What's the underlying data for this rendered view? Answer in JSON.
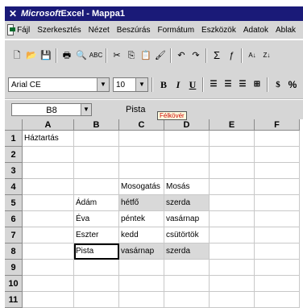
{
  "title": {
    "app": "Microsoft",
    "rest": " Excel - Mappa1"
  },
  "menu": [
    "Fájl",
    "Szerkesztés",
    "Nézet",
    "Beszúrás",
    "Formátum",
    "Eszközök",
    "Adatok",
    "Ablak"
  ],
  "font": {
    "name": "Arial CE",
    "size": "10"
  },
  "format_buttons": [
    "B",
    "I",
    "U",
    "%"
  ],
  "name_box": "B8",
  "formula_content": "Pista",
  "tooltip": "Félkövér",
  "columns": [
    "A",
    "B",
    "C",
    "D",
    "E",
    "F"
  ],
  "rows": [
    "1",
    "2",
    "3",
    "4",
    "5",
    "6",
    "7",
    "8",
    "9",
    "10",
    "11"
  ],
  "cells": {
    "A1": "Háztartás",
    "C4": "Mosogatás",
    "D4": "Mosás",
    "B5": "Ádám",
    "C5": "hétfő",
    "D5": "szerda",
    "B6": "Éva",
    "C6": "péntek",
    "D6": "vasárnap",
    "B7": "Eszter",
    "C7": "kedd",
    "D7": "csütörtök",
    "B8": "Pista",
    "C8": "vasárnap",
    "D8": "szerda"
  },
  "icons": [
    "excel-x-icon",
    "new-doc-icon",
    "open-icon",
    "save-icon",
    "print-icon",
    "preview-icon",
    "spelling-icon",
    "cut-icon",
    "copy-icon",
    "paste-icon",
    "format-painter-icon",
    "undo-icon",
    "redo-icon",
    "autosum-icon",
    "function-icon",
    "sort-asc-icon",
    "sort-desc-icon"
  ]
}
